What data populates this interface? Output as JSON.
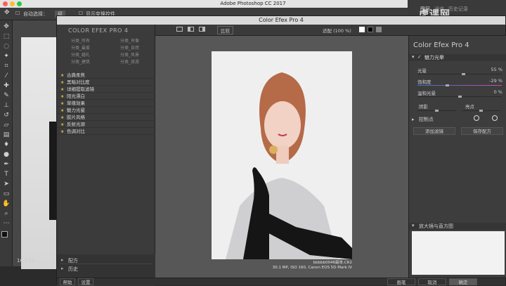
{
  "mac": {
    "app_title": "Adobe Photoshop CC 2017"
  },
  "ps_options": {
    "auto_select_label": "自动选择：",
    "auto_select_value": "组",
    "show_transform": "显示变换控件"
  },
  "ps_tools": [
    "move-tool",
    "marquee-tool",
    "lasso-tool",
    "magic-wand-tool",
    "crop-tool",
    "eyedropper-tool",
    "healing-brush-tool",
    "brush-tool",
    "clone-stamp-tool",
    "history-brush-tool",
    "eraser-tool",
    "gradient-tool",
    "blur-tool",
    "dodge-tool",
    "pen-tool",
    "type-tool",
    "path-selection-tool",
    "shape-tool",
    "hand-tool",
    "zoom-tool"
  ],
  "ps_doc": {
    "zoom": "16.67%"
  },
  "ps_right_tabs": [
    "图层",
    "通道",
    "历史记录"
  ],
  "cep": {
    "window_title": "Color Efex Pro 4",
    "brand_left": "COLOR EFEX PRO 4",
    "brand_right_a": "Color Efex Pro",
    "brand_right_b": "4",
    "toolbar": {
      "compare": "比较",
      "zoom_label": "适配 (100 %)"
    },
    "categories": [
      [
        "分类_所有",
        "分类_肖像"
      ],
      [
        "分类_最爱",
        "分类_自然"
      ],
      [
        "分类_婚礼",
        "分类_风景"
      ],
      [
        "分类_建筑",
        "分类_旅游"
      ]
    ],
    "filters": [
      "古典柔焦",
      "黑暗对比度",
      "详细提取滤镜",
      "阳光漂白",
      "草缘效果",
      "魅力光晕",
      "胶片风格",
      "反射光源",
      "色调对比"
    ],
    "left_bottom": {
      "recipes": "配方",
      "history": "历史"
    },
    "photo_caption_1": "bbbbb0046副本.CR2",
    "photo_caption_2": "30.1 MP, ISO 160, Canon EOS 5D Mark IV",
    "filter_name": "魅力光晕",
    "sliders": [
      {
        "label": "光晕",
        "value": "55 %",
        "pos": 0.55
      },
      {
        "label": "饱和度",
        "value": "-29 %",
        "pos": 0.35
      },
      {
        "label": "温和光晕",
        "value": "0 %",
        "pos": 0.5
      }
    ],
    "shadow_label": "阴影",
    "highlight_label": "亮点",
    "control_points": "控制点",
    "add_filter": "添加滤镜",
    "save_recipe": "保存配方",
    "loupe": "放大镜与直方图",
    "bottom": {
      "help": "帮助",
      "settings": "设置",
      "brush": "画笔",
      "cancel": "取消",
      "ok": "确定"
    }
  },
  "watermark": "虎课网",
  "colors": {
    "accent_star": "#d8b84a",
    "window_bg": "#4a4a4a"
  }
}
